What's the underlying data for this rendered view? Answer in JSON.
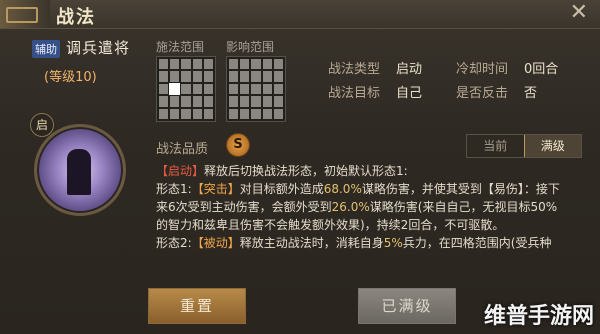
{
  "window": {
    "title": "战法",
    "close_glyph": "✕"
  },
  "left": {
    "role_tag": "辅助",
    "name": "调兵遣将",
    "level": "(等级10)",
    "portrait_badge": "启"
  },
  "ranges": {
    "cast_label": "施法范围",
    "effect_label": "影响范围",
    "cast_grid": [
      0,
      0,
      0,
      0,
      0,
      0,
      0,
      0,
      0,
      0,
      0,
      1,
      0,
      0,
      0,
      0,
      0,
      0,
      0,
      0,
      0,
      0,
      0,
      0,
      0
    ],
    "effect_grid": [
      0,
      0,
      0,
      0,
      0,
      0,
      0,
      0,
      0,
      0,
      0,
      0,
      0,
      0,
      0,
      0,
      0,
      0,
      0,
      0,
      0,
      0,
      0,
      0,
      0
    ]
  },
  "info": {
    "type_label": "战法类型",
    "type_value": "启动",
    "target_label": "战法目标",
    "target_value": "自己",
    "cooldown_label": "冷却时间",
    "cooldown_value": "0回合",
    "counter_label": "是否反击",
    "counter_value": "否"
  },
  "quality": {
    "label": "战法品质",
    "value": "S"
  },
  "tabs": {
    "current": "当前",
    "maxed": "满级"
  },
  "description": {
    "line1_tag": "【启动】",
    "line1_text": "释放后切换战法形态，初始默认形态1:",
    "line2_prefix": "形态1:",
    "line2_tag": "【突击】",
    "line2_a": "对目标额外造成",
    "line2_pct": "68.0%",
    "line2_b": "谋略伤害，并使其受到【易伤】：接下",
    "line3_a": "来6次受到主动伤害，会额外受到",
    "line3_pct": "26.0%",
    "line3_b": "谋略伤害(来自自己，无视目标50%",
    "line4": "的智力和兹卑且伤害不会触发额外效果)，持续2回合，不可驱散。",
    "line5_prefix": "形态2:",
    "line5_tag": "【被动】",
    "line5_a": "释放主动战法时，消耗自身",
    "line5_pct": "5%",
    "line5_b": "兵力，在四格范围内(受兵种"
  },
  "buttons": {
    "reset": "重置",
    "maxed": "已满级"
  },
  "watermark": "维普手游网",
  "colors": {
    "accent_gold": "#e2c070",
    "highlight_red": "#e75a44",
    "highlight_orange": "#f0a74a"
  }
}
